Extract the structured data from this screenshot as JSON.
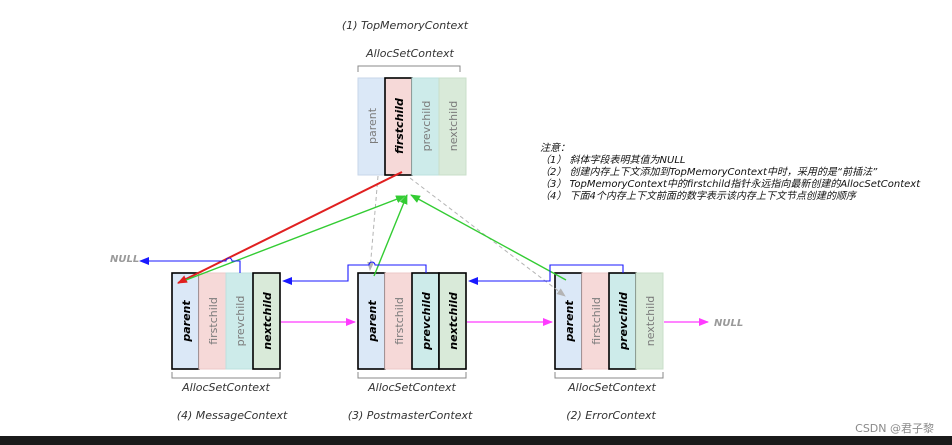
{
  "colors": {
    "parent_fill": "#dbe8f7",
    "firstchild_fill": "#f6d9d8",
    "prevchild_fill": "#cdebea",
    "nextchild_fill": "#d9ead9",
    "red_arrow": "#e02020",
    "green_arrow": "#33cc33",
    "blue_arrow": "#1a1aff",
    "magenta_arrow": "#ff3bff",
    "dashed_arrow": "#b4b4b4"
  },
  "top": {
    "title": "(1) TopMemoryContext",
    "struct_label": "AllocSetContext",
    "fields": [
      {
        "label": "parent",
        "bold": false
      },
      {
        "label": "firstchild",
        "bold": true
      },
      {
        "label": "prevchild",
        "bold": false
      },
      {
        "label": "nextchild",
        "bold": false
      }
    ]
  },
  "children": [
    {
      "title": "(4) MessageContext",
      "struct_label": "AllocSetContext",
      "fields": [
        {
          "label": "parent",
          "bold": true
        },
        {
          "label": "firstchild",
          "bold": false
        },
        {
          "label": "prevchild",
          "bold": false
        },
        {
          "label": "nextchild",
          "bold": true
        }
      ]
    },
    {
      "title": "(3) PostmasterContext",
      "struct_label": "AllocSetContext",
      "fields": [
        {
          "label": "parent",
          "bold": true
        },
        {
          "label": "firstchild",
          "bold": false
        },
        {
          "label": "prevchild",
          "bold": true
        },
        {
          "label": "nextchild",
          "bold": true
        }
      ]
    },
    {
      "title": "(2) ErrorContext",
      "struct_label": "AllocSetContext",
      "fields": [
        {
          "label": "parent",
          "bold": true
        },
        {
          "label": "firstchild",
          "bold": false
        },
        {
          "label": "prevchild",
          "bold": true
        },
        {
          "label": "nextchild",
          "bold": false
        }
      ]
    }
  ],
  "null_left": "NULL",
  "null_right": "NULL",
  "notes": {
    "title": "注意：",
    "lines": [
      "（1） 斜体字段表明其值为NULL",
      "（2） 创建内存上下文添加到TopMemoryContext中时，采用的是“前插法”",
      "（3） TopMemoryContext中的firstchild指针永远指向最新创建的AllocSetContext",
      "（4） 下面4个内存上下文前面的数字表示该内存上下文节点创建的顺序"
    ]
  },
  "watermark": "CSDN @君子黎"
}
